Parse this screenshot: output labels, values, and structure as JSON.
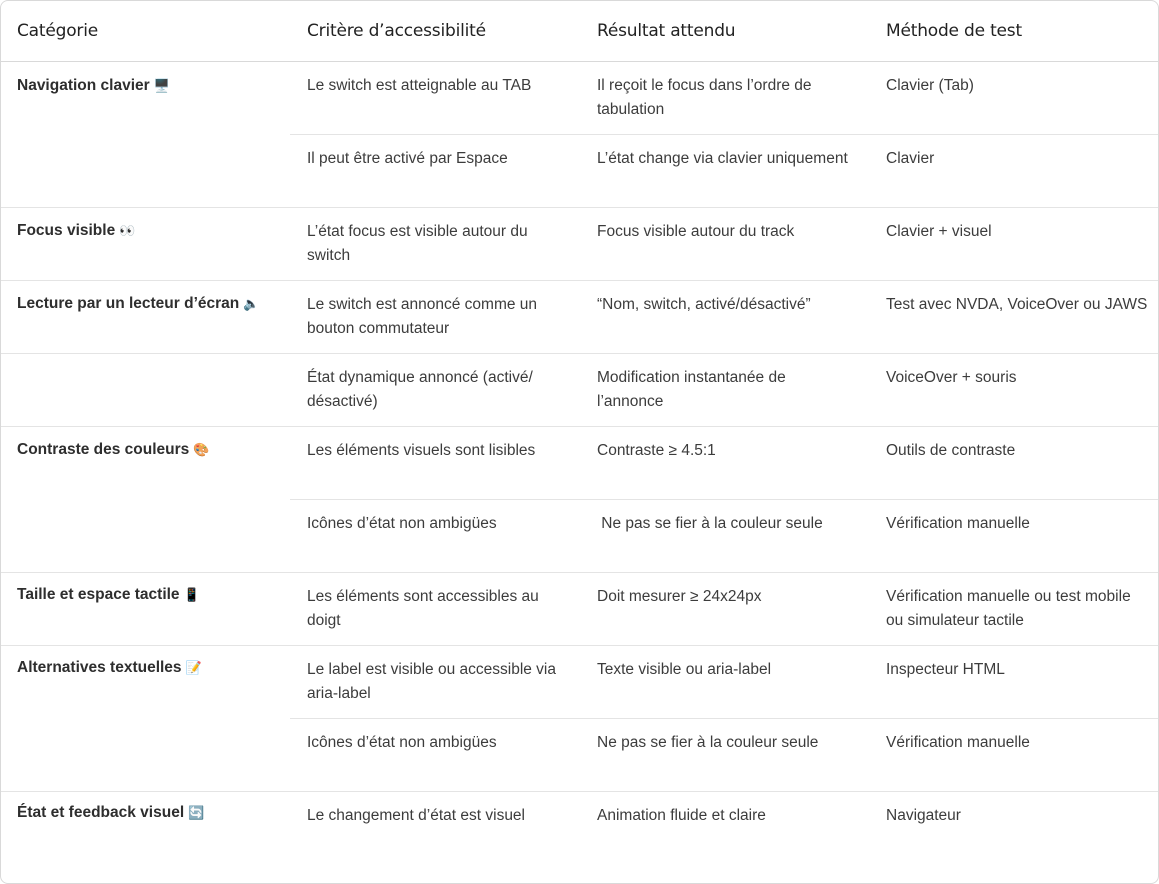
{
  "columns": [
    "Catégorie",
    "Critère d’accessibilité",
    "Résultat attendu",
    "Méthode de test"
  ],
  "categories": [
    {
      "label": "Navigation clavier",
      "emoji": "🖥️"
    },
    {
      "label": "Focus visible",
      "emoji": "👀"
    },
    {
      "label": "Lecture par un lecteur d’écran",
      "emoji": "🔈"
    },
    {
      "label": "Contraste des couleurs",
      "emoji": "🎨"
    },
    {
      "label": "Taille et espace tactile",
      "emoji": "📱"
    },
    {
      "label": "Alternatives textuelles",
      "emoji": "📝"
    },
    {
      "label": "État et feedback visuel",
      "emoji": "🔄"
    }
  ],
  "rows": [
    {
      "criterion": "Le switch est atteignable au TAB",
      "expected": "Il reçoit le focus dans l’ordre de tabulation",
      "method": "Clavier (Tab)"
    },
    {
      "criterion": "Il peut être activé par Espace",
      "expected": "L’état change via clavier uniquement",
      "method": "Clavier"
    },
    {
      "criterion": "L’état focus est visible autour du switch",
      "expected": "Focus visible autour du track",
      "method": "Clavier + visuel"
    },
    {
      "criterion": "Le switch est annoncé comme un bouton commutateur",
      "expected": "“Nom, switch, activé/désactivé”",
      "method": "Test avec NVDA, VoiceOver ou JAWS"
    },
    {
      "criterion": "État dynamique annoncé (activé/ désactivé)",
      "expected": " Modification instantanée de l’annonce",
      "method": "VoiceOver + souris"
    },
    {
      "criterion": "Les éléments visuels sont lisibles",
      "expected": "Contraste ≥ 4.5:1",
      "method": "Outils de contraste"
    },
    {
      "criterion": "Icônes d’état non ambigües",
      "expected": " Ne pas se fier à la couleur seule",
      "method": "Vérification manuelle"
    },
    {
      "criterion": "Les éléments sont accessibles au doigt",
      "expected": "Doit mesurer ≥ 24x24px",
      "method": "Vérification manuelle ou test mobile ou simulateur tactile"
    },
    {
      "criterion": "Le label est visible ou accessible via aria-label",
      "expected": "Texte visible ou aria-label",
      "method": "Inspecteur HTML"
    },
    {
      "criterion": "Icônes d’état non ambigües",
      "expected": "Ne pas se fier à la couleur seule",
      "method": "Vérification manuelle"
    },
    {
      "criterion": "Le changement d’état est visuel",
      "expected": "Animation fluide et claire",
      "method": "Navigateur"
    }
  ]
}
